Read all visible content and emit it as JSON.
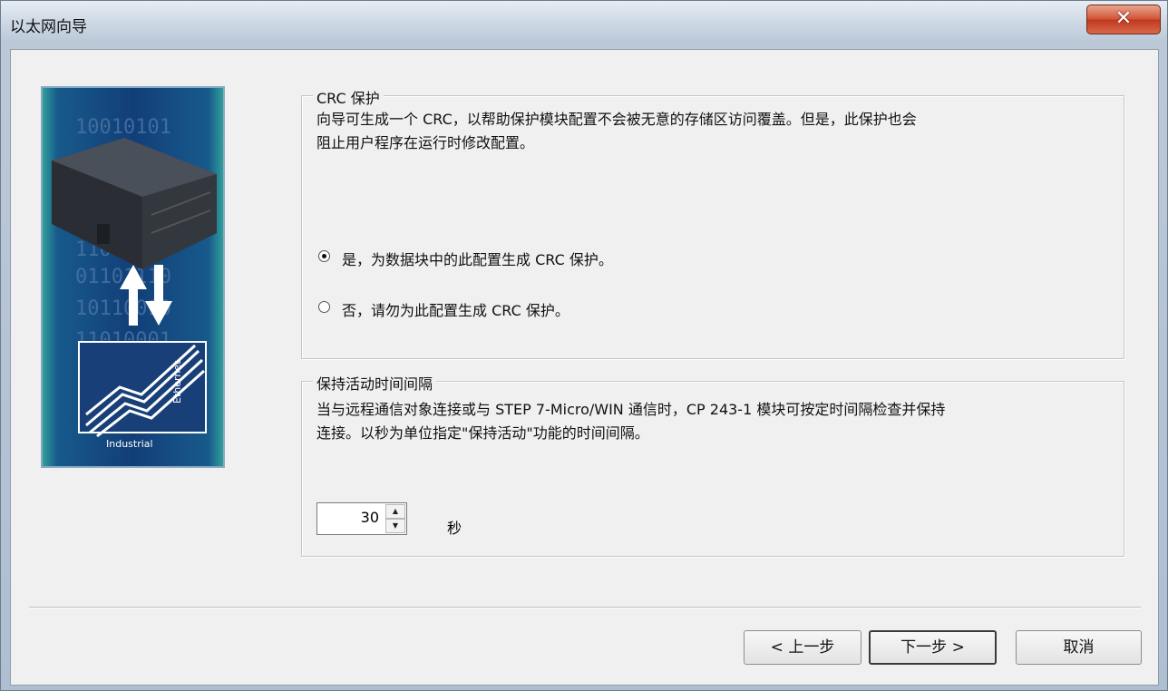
{
  "window": {
    "title": "以太网向导",
    "close_glyph": "✕"
  },
  "crc_group": {
    "title": "CRC 保护",
    "description": "向导可生成一个 CRC，以帮助保护模块配置不会被无意的存储区访问覆盖。但是，此保护也会\n阻止用户程序在运行时修改配置。",
    "options": [
      {
        "label": "是，为数据块中的此配置生成 CRC 保护。",
        "checked": true
      },
      {
        "label": "否，请勿为此配置生成 CRC 保护。",
        "checked": false
      }
    ]
  },
  "keepalive_group": {
    "title": "保持活动时间间隔",
    "description": "当与远程通信对象连接或与 STEP 7-Micro/WIN 通信时，CP 243-1 模块可按定时间隔检查并保持\n连接。以秒为单位指定\"保持活动\"功能的时间间隔。",
    "interval_value": "30",
    "unit": "秒"
  },
  "illustration": {
    "binary_rows": [
      "10010101",
      "11000101",
      "01101110",
      "10110010",
      "11010001"
    ],
    "logo_text_industrial": "Industrial",
    "logo_text_ethernet": "Ethernet"
  },
  "buttons": {
    "prev": "< 上一步",
    "next": "下一步 >",
    "cancel": "取消"
  },
  "colors": {
    "illustration_blue": "#123e78",
    "teal": "#2f9f9a",
    "close_red": "#c0391f"
  }
}
